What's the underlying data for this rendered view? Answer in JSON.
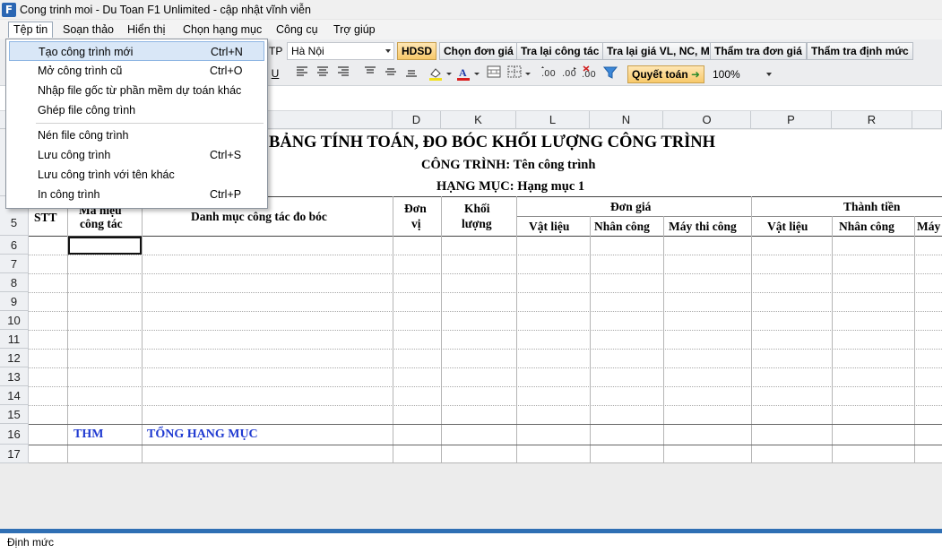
{
  "window": {
    "title": "Cong trinh moi - Du Toan F1 Unlimited - cập nhật vĩnh viễn",
    "icon_letter": "F"
  },
  "menubar": [
    "Tệp tin",
    "Soạn thảo",
    "Hiển thị",
    "Chọn hạng mục",
    "Công cụ",
    "Trợ giúp"
  ],
  "toolbar1": {
    "region_prefix": "TP",
    "region_value": "Hà Nội",
    "buttons": [
      "HDSD",
      "Chọn đơn giá",
      "Tra lại công tác",
      "Tra lại giá VL, NC, M",
      "Thẩm tra đơn giá",
      "Thẩm tra định mức"
    ]
  },
  "toolbar2": {
    "underline_label": "U",
    "settle_label": "Quyết toán",
    "zoom": "100%"
  },
  "file_menu": {
    "items": [
      {
        "label": "Tạo công trình mới",
        "shortcut": "Ctrl+N"
      },
      {
        "label": "Mở công trình cũ",
        "shortcut": "Ctrl+O"
      },
      {
        "label": "Nhập file gốc từ phần mềm dự toán khác",
        "shortcut": ""
      },
      {
        "label": "Ghép file công trình",
        "shortcut": ""
      },
      {
        "label": "Nén file công trình",
        "shortcut": ""
      },
      {
        "label": "Lưu công trình",
        "shortcut": "Ctrl+S"
      },
      {
        "label": "Lưu công trình với tên khác",
        "shortcut": ""
      },
      {
        "label": "In công trình",
        "shortcut": "Ctrl+P"
      }
    ]
  },
  "sheet": {
    "columns": [
      "C",
      "D",
      "K",
      "L",
      "N",
      "O",
      "P",
      "R"
    ],
    "title": "BẢNG TÍNH TOÁN, ĐO BÓC KHỐI LƯỢNG CÔNG TRÌNH",
    "project_line": "CÔNG TRÌNH: Tên công trình",
    "item_line": "HẠNG MỤC: Hạng mục 1",
    "headers": {
      "stt": "STT",
      "code_top": "Mã hiệu",
      "code_bottom": "công tác",
      "desc": "Danh mục công tác đo bóc",
      "unit_top": "Đơn",
      "unit_bottom": "vị",
      "qty_top": "Khối",
      "qty_bottom": "lượng",
      "unit_price": "Đơn giá",
      "total": "Thành tiền",
      "sub": [
        "Vật liệu",
        "Nhân công",
        "Máy thi công",
        "Vật liệu",
        "Nhân công",
        "Máy"
      ]
    },
    "row_numbers": [
      "5",
      "6",
      "7",
      "8",
      "9",
      "10",
      "11",
      "12",
      "13",
      "14",
      "15",
      "16",
      "17"
    ],
    "total_row": {
      "code": "THM",
      "label": "TỔNG HẠNG MỤC"
    }
  },
  "status": {
    "text": "Định mức"
  },
  "colors": {
    "accent_blue": "#2f6fb4",
    "total_text": "#1f3ad1",
    "highlight_button": "#f7c96b"
  }
}
